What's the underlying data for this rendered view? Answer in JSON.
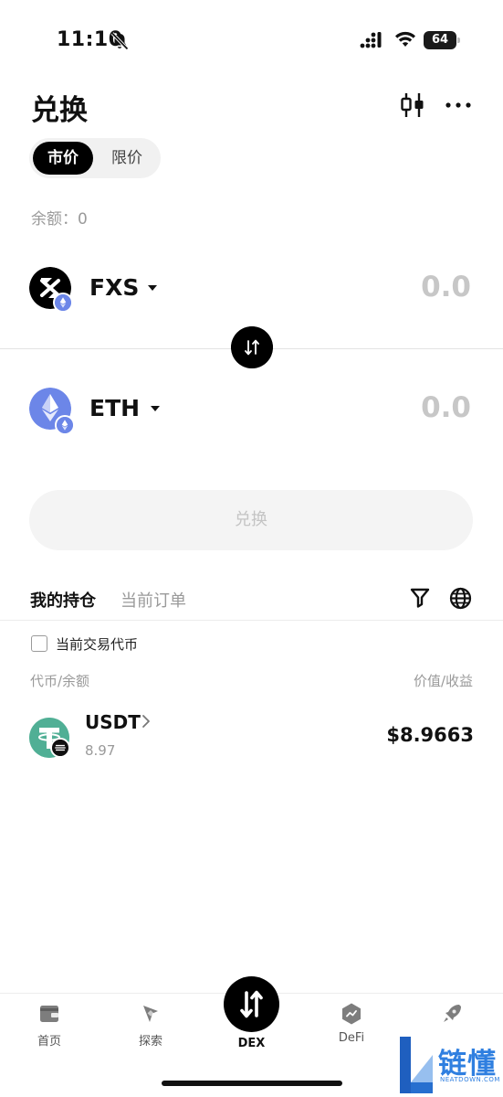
{
  "status_bar": {
    "time": "11:10",
    "battery": "64"
  },
  "header": {
    "title": "兑换"
  },
  "order_type": {
    "market": "市价",
    "limit": "限价"
  },
  "balance_label": "余额：0",
  "from_token": {
    "symbol": "FXS",
    "amount": "0.0"
  },
  "to_token": {
    "symbol": "ETH",
    "amount": "0.0"
  },
  "swap_button_label": "兑换",
  "holdings": {
    "tab_holdings": "我的持仓",
    "tab_orders": "当前订单",
    "current_pair_label": "当前交易代币",
    "col_token_balance": "代币/余额",
    "col_value_pnl": "价值/收益",
    "assets": [
      {
        "symbol": "USDT",
        "balance": "8.97",
        "value": "$8.9663"
      }
    ]
  },
  "bottom_nav": {
    "home": "首页",
    "explore": "探索",
    "dex": "DEX",
    "defi": "DeFi"
  },
  "watermark": {
    "cn": "链懂",
    "en": "NEATDOWN.COM"
  },
  "colors": {
    "eth_blue": "#6c86e8",
    "usdt_green": "#50af95",
    "watermark_blue": "#2f7fe0"
  }
}
